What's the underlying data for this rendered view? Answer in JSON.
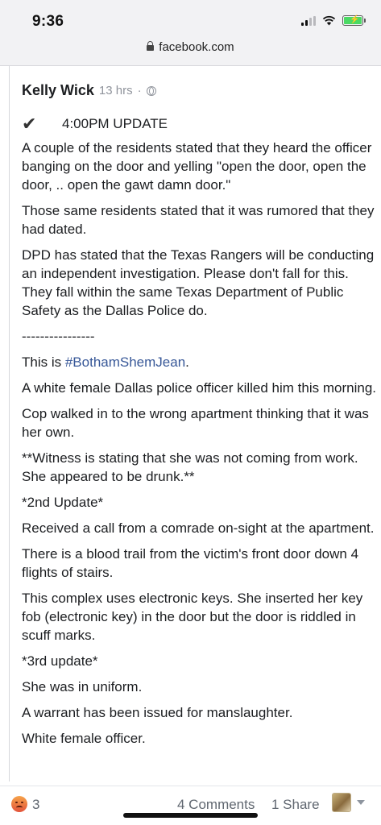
{
  "status_bar": {
    "time": "9:36",
    "icons": [
      "cellular-signal-icon",
      "wifi-icon",
      "battery-charging-icon"
    ],
    "battery_color": "#4cd964"
  },
  "browser": {
    "url": "facebook.com",
    "lock_icon": "lock-icon"
  },
  "post": {
    "author": "Kelly Wick",
    "timestamp": "13 hrs",
    "separator": "·",
    "privacy_icon": "globe-icon",
    "update_icon": "checkmark-icon",
    "update_label": "4:00PM UPDATE",
    "paragraphs": [
      "A couple of the residents stated that they heard the officer banging on the door and yelling \"open the door, open the door, .. open the gawt damn door.\"",
      "Those same residents stated that it was rumored that they had dated.",
      "DPD has stated that the Texas Rangers will be conducting an independent investigation. Please don't fall for this. They fall within the same Texas Department of Public Safety as the Dallas Police do.",
      "----------------"
    ],
    "this_is_prefix": "This is ",
    "hashtag": "#BothamShemJean",
    "this_is_suffix": ".",
    "paragraphs_2": [
      "A white female Dallas police officer killed him this morning.",
      "Cop walked in to the wrong apartment thinking that it was her own.",
      "**Witness is stating that she was not coming from work. She appeared to be drunk.**",
      "*2nd Update*",
      "Received a call from a comrade on-sight at the apartment.",
      "There is a blood trail from the victim's front door down 4 flights of stairs.",
      "This complex uses electronic keys. She inserted her key fob (electronic key) in the door but the door is riddled in scuff marks.",
      "*3rd update*",
      "She was in uniform.",
      "A warrant has been issued for manslaughter.",
      "White female officer."
    ]
  },
  "footer": {
    "reaction_icon": "angry-reaction-icon",
    "reaction_count": "3",
    "comments": "4 Comments",
    "shares": "1 Share",
    "dropdown_icon": "chevron-down-icon"
  },
  "colors": {
    "link": "#385898",
    "meta": "#90949c"
  }
}
